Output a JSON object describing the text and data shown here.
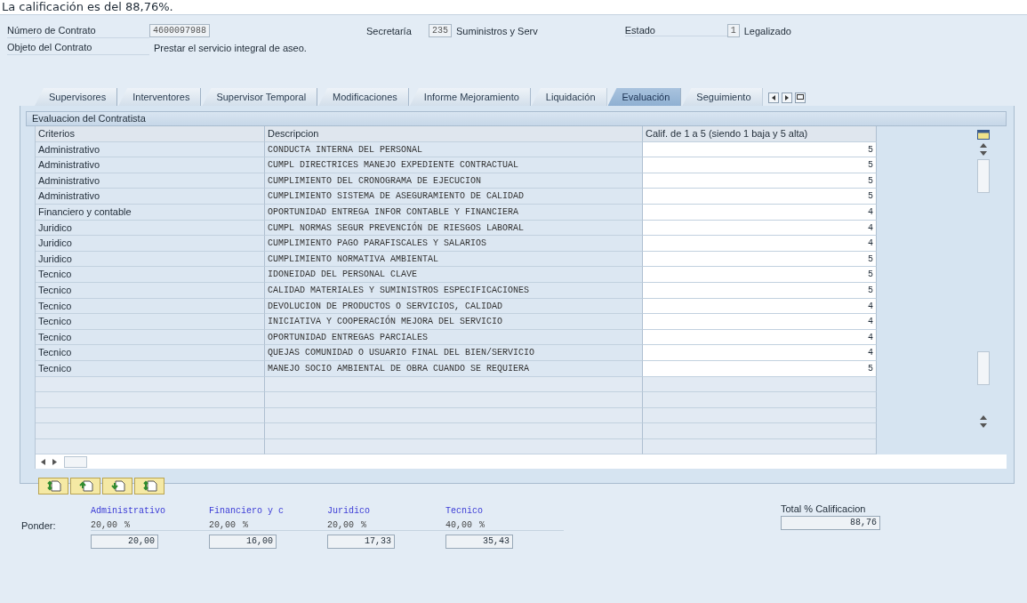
{
  "caption": "La calificación es del 88,76%.",
  "header": {
    "contract": {
      "label": "Número de Contrato",
      "value": "4600097988"
    },
    "secretaria": {
      "label": "Secretaría",
      "value": "235",
      "text": "Suministros y Serv"
    },
    "estado": {
      "label": "Estado",
      "value": "1",
      "text": "Legalizado"
    },
    "object": {
      "label": "Objeto del Contrato",
      "value": "Prestar el servicio integral de aseo."
    }
  },
  "tabs": [
    {
      "label": "Supervisores",
      "selected": false
    },
    {
      "label": "Interventores",
      "selected": false
    },
    {
      "label": "Supervisor Temporal",
      "selected": false
    },
    {
      "label": "Modificaciones",
      "selected": false
    },
    {
      "label": "Informe Mejoramiento",
      "selected": false
    },
    {
      "label": "Liquidación",
      "selected": false
    },
    {
      "label": "Evaluación",
      "selected": true
    },
    {
      "label": "Seguimiento",
      "selected": false
    }
  ],
  "group": {
    "title": "Evaluacion del Contratista",
    "table": {
      "columns": [
        "Criterios",
        "Descripcion",
        "Calif. de 1 a 5 (siendo 1 baja y 5 alta)"
      ],
      "rows": [
        [
          "Administrativo",
          "CONDUCTA INTERNA DEL PERSONAL",
          "5"
        ],
        [
          "Administrativo",
          "CUMPL DIRECTRICES MANEJO EXPEDIENTE CONTRACTUAL",
          "5"
        ],
        [
          "Administrativo",
          "CUMPLIMIENTO DEL CRONOGRAMA DE EJECUCION",
          "5"
        ],
        [
          "Administrativo",
          "CUMPLIMIENTO SISTEMA DE ASEGURAMIENTO DE CALIDAD",
          "5"
        ],
        [
          "Financiero y contable",
          "OPORTUNIDAD ENTREGA INFOR CONTABLE Y FINANCIERA",
          "4"
        ],
        [
          "Juridico",
          "CUMPL NORMAS SEGUR PREVENCIÓN DE RIESGOS LABORAL",
          "4"
        ],
        [
          "Juridico",
          "CUMPLIMIENTO PAGO PARAFISCALES Y SALARIOS",
          "4"
        ],
        [
          "Juridico",
          "CUMPLIMIENTO NORMATIVA AMBIENTAL",
          "5"
        ],
        [
          "Tecnico",
          "IDONEIDAD DEL PERSONAL CLAVE",
          "5"
        ],
        [
          "Tecnico",
          "CALIDAD MATERIALES Y SUMINISTROS ESPECIFICACIONES",
          "5"
        ],
        [
          "Tecnico",
          "DEVOLUCION DE PRODUCTOS O SERVICIOS, CALIDAD",
          "4"
        ],
        [
          "Tecnico",
          "INICIATIVA Y COOPERACIÓN MEJORA DEL SERVICIO",
          "4"
        ],
        [
          "Tecnico",
          "OPORTUNIDAD ENTREGAS PARCIALES",
          "4"
        ],
        [
          "Tecnico",
          "QUEJAS COMUNIDAD O USUARIO FINAL DEL BIEN/SERVICIO",
          "4"
        ],
        [
          "Tecnico",
          "MANEJO SOCIO AMBIENTAL DE OBRA CUANDO SE REQUIERA",
          "5"
        ]
      ]
    }
  },
  "summary": {
    "label": "Ponder:",
    "categories": [
      {
        "name": "Administrativo",
        "weight": "20,00",
        "unit": "%",
        "score": "20,00"
      },
      {
        "name": "Financiero y c",
        "weight": "20,00",
        "unit": "%",
        "score": "16,00"
      },
      {
        "name": "Juridico",
        "weight": "20,00",
        "unit": "%",
        "score": "17,33"
      },
      {
        "name": "Tecnico",
        "weight": "40,00",
        "unit": "%",
        "score": "35,43"
      }
    ],
    "total": {
      "label": "Total % Calificacion",
      "value": "88,76"
    }
  }
}
